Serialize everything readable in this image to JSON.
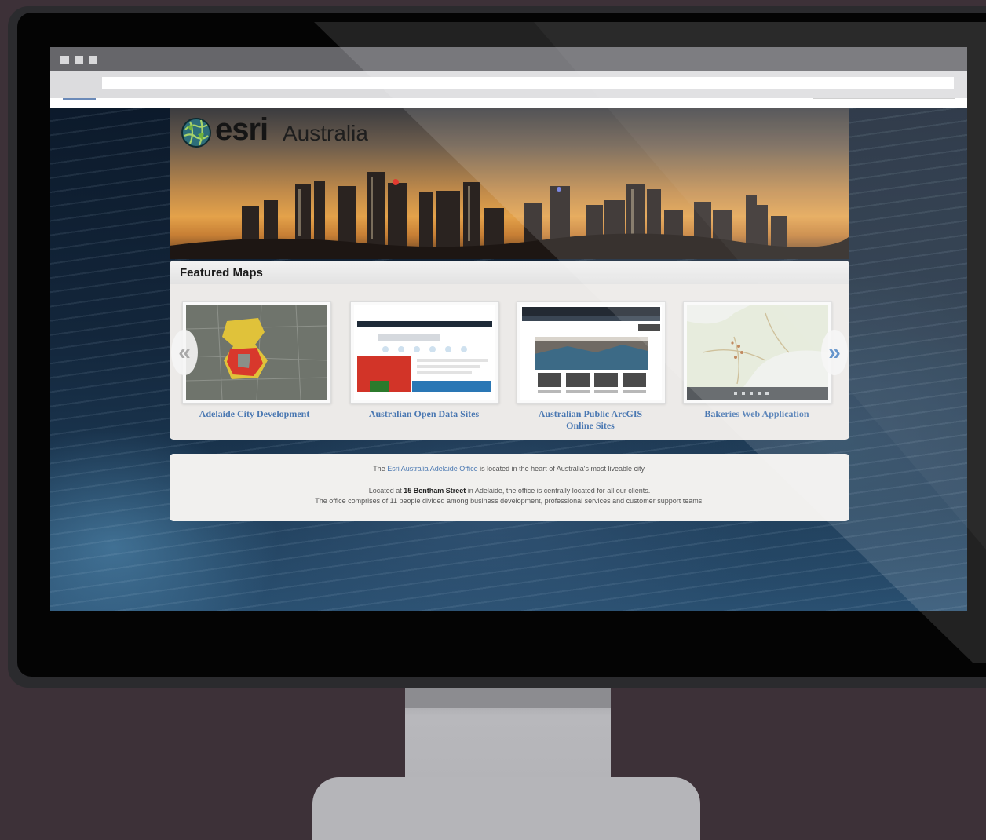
{
  "browser": {
    "address_value": ""
  },
  "banner": {
    "logo_word": "esri",
    "logo_region": "Australia"
  },
  "featured": {
    "title": "Featured Maps",
    "prev_arrow": "«",
    "next_arrow": "»",
    "cards": [
      {
        "label": "Adelaide City Development"
      },
      {
        "label": "Australian Open Data Sites"
      },
      {
        "label_line1": "Australian Public ArcGIS",
        "label_line2": "Online Sites"
      },
      {
        "label": "Bakeries Web Application"
      }
    ]
  },
  "info": {
    "line1_pre": "The",
    "line1_link": "Esri Australia Adelaide Office",
    "line1_post": "is located in the heart of Australia's most liveable city.",
    "line2_pre": "Located at",
    "line2_strong": "15 Bentham Street",
    "line2_post": "in Adelaide, the office is centrally located for all our clients.",
    "line3": "The office comprises of 11 people divided among business development, professional services and customer support teams."
  },
  "colors": {
    "link": "#4a78b2",
    "next_arrow": "#4a82c3",
    "backdrop": "#3d3138"
  }
}
